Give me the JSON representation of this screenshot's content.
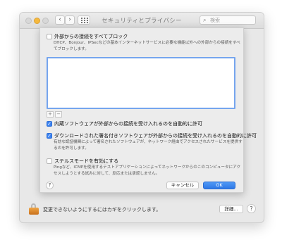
{
  "window": {
    "title": "セキュリティとプライバシー",
    "nav_back": "‹",
    "nav_forward": "›",
    "search_icon": "magnifier-icon",
    "search_placeholder": "検索"
  },
  "bottom_bar": {
    "lock_text": "変更できないようにするにはカギをクリックします。",
    "advanced_label": "詳細...",
    "help_label": "?"
  },
  "sheet": {
    "block_all": {
      "checked": false,
      "label": "外部からの接続をすべてブロック",
      "description": "DHCP、Bonjour、IPSecなどの基本インターネットサービスに必要な機能以外への外部からの接続をすべてブロックします。"
    },
    "list_add": "+",
    "list_remove": "−",
    "builtin": {
      "checked": true,
      "label": "内蔵ソフトウェアが外部からの接続を受け入れるのを自動的に許可"
    },
    "signed": {
      "checked": true,
      "label": "ダウンロードされた署名付きソフトウェアが外部からの接続を受け入れるのを自動的に許可",
      "description": "有効な認証機関によって署名されたソフトウェアが、ネットワーク経由でアクセスされたサービスを提供するのを許可します。"
    },
    "stealth": {
      "checked": false,
      "label": "ステルスモードを有効にする",
      "description": "Pingなど、ICMPを使用するテストアプリケーションによってネットワークからのこのコンピュータにアクセスしようとする試みに対して、反応または承認しません。"
    },
    "help_label": "?",
    "cancel_label": "キャンセル",
    "ok_label": "OK"
  },
  "colors": {
    "accent": "#3b82f0",
    "minimize": "#f5b93e",
    "lock": "#e08a2c"
  }
}
